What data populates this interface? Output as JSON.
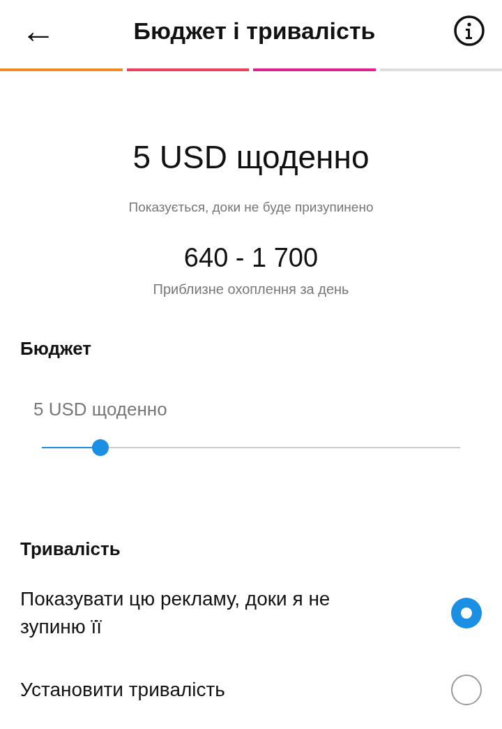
{
  "header": {
    "back_icon": "←",
    "title": "Бюджет і тривалість"
  },
  "progress": [
    {
      "color": "#f08a24"
    },
    {
      "color": "#ec3f5c"
    },
    {
      "color": "#e0208c"
    },
    {
      "color": "#dddddd"
    }
  ],
  "summary": {
    "amount": "5 USD щоденно",
    "note": "Показується, доки не буде призупинено",
    "reach": "640 - 1 700",
    "reach_label": "Приблизне охоплення за день"
  },
  "budget": {
    "heading": "Бюджет",
    "slider_label": "5 USD щоденно",
    "level": 0.14
  },
  "duration": {
    "heading": "Тривалість",
    "options": [
      {
        "label": "Показувати цю рекламу, доки я не зупиню її",
        "selected": true
      },
      {
        "label": "Установити тривалість",
        "selected": false
      }
    ]
  }
}
